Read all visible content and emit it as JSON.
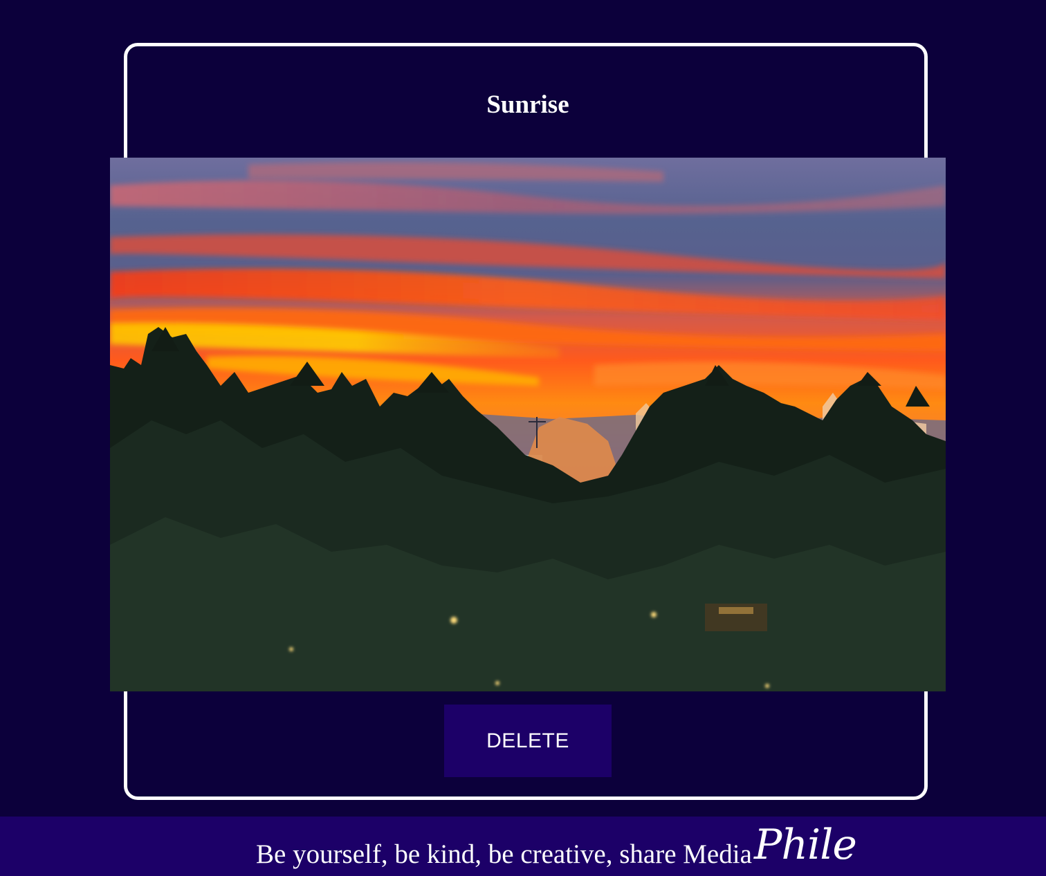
{
  "post": {
    "title": "Sunrise",
    "image_alt": "Sunrise"
  },
  "actions": {
    "delete_label": "DELETE"
  },
  "footer": {
    "tagline": "Be yourself, be kind, be creative, share Media",
    "logo_text": "Phile"
  },
  "colors": {
    "background": "#0c003b",
    "footer_background": "#1c0068",
    "button_background": "#1c0068",
    "card_border": "#ffffff",
    "text": "#ffffff"
  }
}
